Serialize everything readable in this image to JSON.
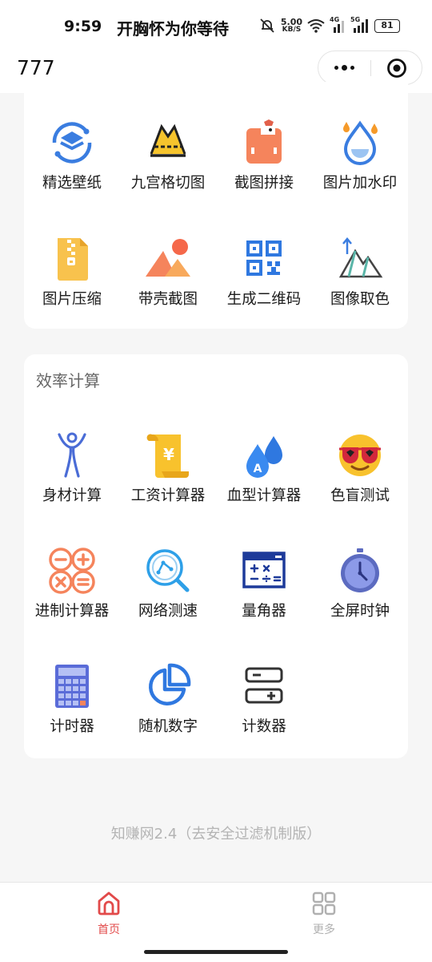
{
  "status_bar": {
    "time": "9:59",
    "ticker": "开胸怀为你等待",
    "net_speed": "5.00",
    "net_speed_unit": "KB/S",
    "net_type_1": "4G",
    "net_type_2": "5G",
    "battery": "81"
  },
  "header": {
    "title": "777",
    "more_icon": "ellipsis-icon",
    "close_icon": "target-icon"
  },
  "image_tools": [
    {
      "label": "精选壁纸",
      "icon": "wallpaper-layers-icon"
    },
    {
      "label": "九宫格切图",
      "icon": "grid-crop-icon"
    },
    {
      "label": "截图拼接",
      "icon": "screenshot-stitch-icon"
    },
    {
      "label": "图片加水印",
      "icon": "watermark-drop-icon"
    },
    {
      "label": "图片压缩",
      "icon": "zip-file-icon"
    },
    {
      "label": "带壳截图",
      "icon": "mountain-image-icon"
    },
    {
      "label": "生成二维码",
      "icon": "qr-code-icon"
    },
    {
      "label": "图像取色",
      "icon": "color-picker-icon"
    }
  ],
  "efficiency": {
    "title": "效率计算",
    "tools": [
      {
        "label": "身材计算",
        "icon": "body-figure-icon"
      },
      {
        "label": "工资计算器",
        "icon": "salary-scroll-icon"
      },
      {
        "label": "血型计算器",
        "icon": "blood-drops-icon"
      },
      {
        "label": "色盲测试",
        "icon": "sunglasses-face-icon"
      },
      {
        "label": "进制计算器",
        "icon": "math-operators-icon"
      },
      {
        "label": "网络测速",
        "icon": "network-search-icon"
      },
      {
        "label": "量角器",
        "icon": "calculator-board-icon"
      },
      {
        "label": "全屏时钟",
        "icon": "stopwatch-icon"
      },
      {
        "label": "计时器",
        "icon": "calculator-icon"
      },
      {
        "label": "随机数字",
        "icon": "pie-chart-icon"
      },
      {
        "label": "计数器",
        "icon": "counter-icon"
      }
    ]
  },
  "footer": "知赚网2.4（去安全过滤机制版）",
  "tab_bar": {
    "tabs": [
      {
        "label": "首页",
        "icon": "home-icon",
        "active": true
      },
      {
        "label": "更多",
        "icon": "grid-icon",
        "active": false
      }
    ],
    "active_color": "#e24a4a",
    "inactive_color": "#b0b0b0"
  },
  "colors": {
    "background": "#f6f6f6",
    "card": "#ffffff",
    "primary_blue": "#3a7de0",
    "orange": "#f5845c"
  }
}
